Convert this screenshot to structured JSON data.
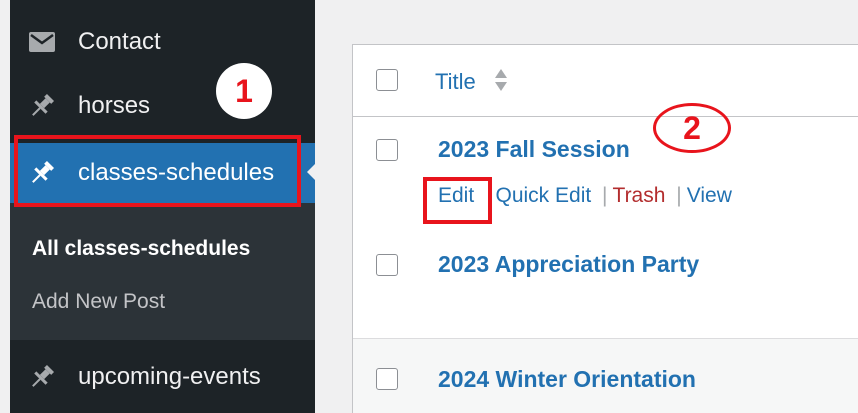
{
  "sidebar": {
    "items": [
      {
        "label": "Contact",
        "icon": "mail-icon"
      },
      {
        "label": "horses",
        "icon": "pin-icon"
      },
      {
        "label": "classes-schedules",
        "icon": "pin-icon"
      },
      {
        "label": "upcoming-events",
        "icon": "pin-icon"
      }
    ],
    "submenu": {
      "all": "All classes-schedules",
      "add": "Add New Post"
    }
  },
  "table": {
    "column_title": "Title",
    "rows": [
      {
        "title": "2023 Fall Session"
      },
      {
        "title": "2023 Appreciation Party"
      },
      {
        "title": "2024 Winter Orientation"
      }
    ],
    "row_actions": {
      "edit": "Edit",
      "quick_edit": "Quick Edit",
      "trash": "Trash",
      "view": "View",
      "separator": "|"
    }
  },
  "annotations": {
    "step1": "1",
    "step2": "2"
  },
  "colors": {
    "sidebar_bg": "#1d2327",
    "active_bg": "#2271b1",
    "link": "#2271b1",
    "trash": "#b32d2e",
    "annotation": "#e8141c"
  }
}
